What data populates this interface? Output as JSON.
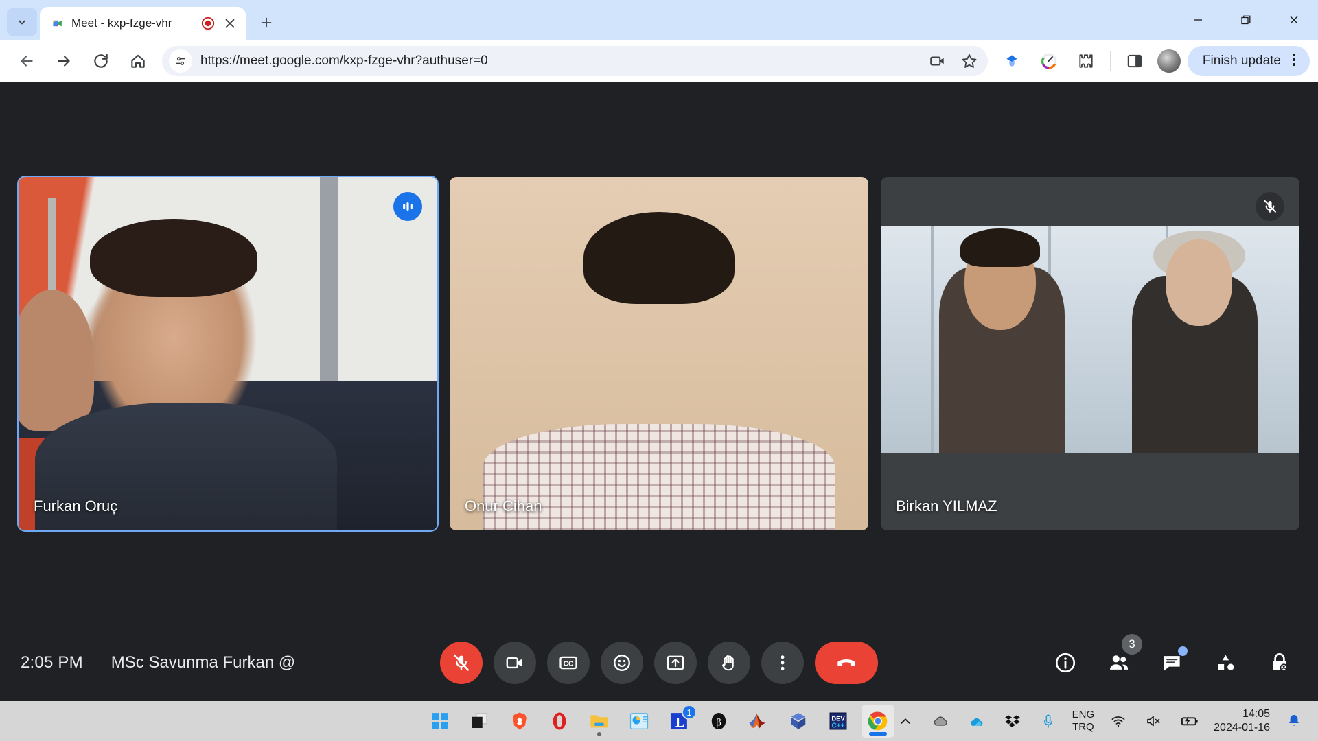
{
  "browser": {
    "tab": {
      "title": "Meet - kxp-fzge-vhr",
      "favicon_name": "google-meet-favicon",
      "recording_icon": "record-indicator-icon",
      "close_icon": "close-icon"
    },
    "new_tab_label": "+",
    "window_controls": {
      "minimize": "minimize-icon",
      "maximize": "maximize-icon",
      "close": "close-icon"
    },
    "toolbar": {
      "back": "back-arrow-icon",
      "forward": "forward-arrow-icon",
      "reload": "reload-icon",
      "home": "home-icon",
      "site_settings": "site-settings-icon",
      "url": "https://meet.google.com/kxp-fzge-vhr?authuser=0",
      "camera_badge": "video-permission-icon",
      "bookmark": "star-icon",
      "extension_gem": "extension-diamond-icon",
      "extension_color": "color-wheel-icon",
      "extensions": "extensions-puzzle-icon",
      "side_panel": "side-panel-icon",
      "profile": "profile-avatar",
      "update_label": "Finish update",
      "menu": "three-dot-menu-icon"
    }
  },
  "meet": {
    "tiles": [
      {
        "name": "Furkan Oruç",
        "state_icon": "speaking-indicator-icon",
        "active": true
      },
      {
        "name": "Onur Cihan",
        "state_icon": "",
        "active": false
      },
      {
        "name": "Birkan YILMAZ",
        "state_icon": "mic-off-icon",
        "active": false
      }
    ],
    "bar": {
      "time": "2:05 PM",
      "meeting_title": "MSc Savunma Furkan @",
      "controls": [
        {
          "name": "microphone-off-button",
          "icon": "mic-off-icon",
          "style": "danger"
        },
        {
          "name": "camera-button",
          "icon": "video-camera-icon",
          "style": "normal"
        },
        {
          "name": "captions-button",
          "icon": "closed-captions-icon",
          "style": "normal"
        },
        {
          "name": "reactions-button",
          "icon": "emoji-smiley-icon",
          "style": "normal"
        },
        {
          "name": "present-screen-button",
          "icon": "present-screen-icon",
          "style": "normal"
        },
        {
          "name": "raise-hand-button",
          "icon": "raised-hand-icon",
          "style": "normal"
        },
        {
          "name": "more-options-button",
          "icon": "three-dot-menu-icon",
          "style": "normal"
        },
        {
          "name": "leave-call-button",
          "icon": "hang-up-phone-icon",
          "style": "hangup"
        }
      ],
      "right_controls": [
        {
          "name": "meeting-details-button",
          "icon": "info-icon",
          "badge": "",
          "dot": false
        },
        {
          "name": "people-button",
          "icon": "people-icon",
          "badge": "3",
          "dot": false
        },
        {
          "name": "chat-button",
          "icon": "chat-bubble-icon",
          "badge": "",
          "dot": true
        },
        {
          "name": "activities-button",
          "icon": "activities-shapes-icon",
          "badge": "",
          "dot": false
        },
        {
          "name": "host-controls-button",
          "icon": "lock-host-icon",
          "badge": "",
          "dot": false
        }
      ]
    }
  },
  "taskbar": {
    "apps": [
      {
        "name": "start-button",
        "icon": "windows-logo-icon"
      },
      {
        "name": "task-view-button",
        "icon": "task-view-icon"
      },
      {
        "name": "brave-browser",
        "icon": "brave-lion-icon"
      },
      {
        "name": "opera-browser",
        "icon": "opera-o-icon"
      },
      {
        "name": "file-explorer",
        "icon": "folder-icon"
      },
      {
        "name": "presentation-app",
        "icon": "slides-chart-icon"
      },
      {
        "name": "texstudio-app",
        "icon": "latex-l-icon",
        "badge": "1"
      },
      {
        "name": "zotero-app",
        "icon": "dark-circle-icon"
      },
      {
        "name": "matlab-app",
        "icon": "matlab-membrane-icon"
      },
      {
        "name": "virtualbox-app",
        "icon": "virtualbox-cube-icon"
      },
      {
        "name": "dev-cpp-app",
        "icon": "dev-cpp-icon"
      },
      {
        "name": "google-chrome",
        "icon": "chrome-icon",
        "active": true
      }
    ],
    "tray": {
      "overflow": "chevron-up-icon",
      "icons": [
        {
          "name": "cloud-sync-icon"
        },
        {
          "name": "onedrive-icon"
        },
        {
          "name": "dropbox-icon"
        },
        {
          "name": "microphone-icon"
        }
      ],
      "language_line1": "ENG",
      "language_line2": "TRQ",
      "wifi": "wifi-icon",
      "volume": "volume-muted-icon",
      "battery": "battery-charging-icon",
      "time": "14:05",
      "date": "2024-01-16",
      "notifications": "bell-icon"
    }
  }
}
